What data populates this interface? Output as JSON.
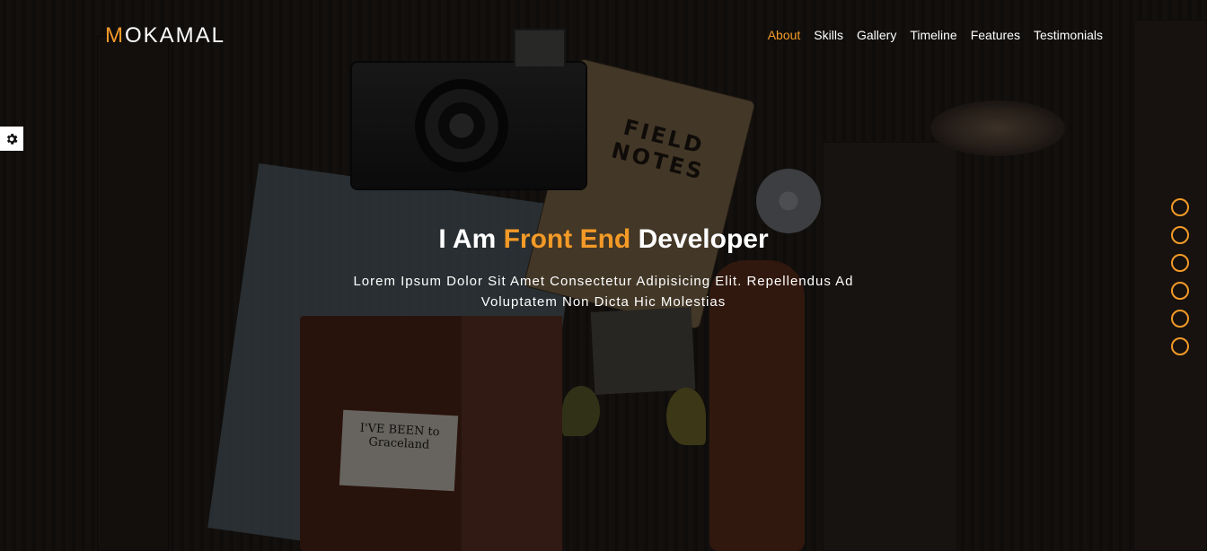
{
  "brand": {
    "logo_first_letter": "M",
    "logo_rest": "OKAMAL"
  },
  "nav": {
    "items": [
      {
        "label": "About",
        "active": true
      },
      {
        "label": "Skills",
        "active": false
      },
      {
        "label": "Gallery",
        "active": false
      },
      {
        "label": "Timeline",
        "active": false
      },
      {
        "label": "Features",
        "active": false
      },
      {
        "label": "Testimonials",
        "active": false
      }
    ]
  },
  "settings": {
    "icon": "gear-icon"
  },
  "hero": {
    "headline_start": "I Am ",
    "headline_highlight": "Front End",
    "headline_end": " Developer",
    "subtitle": "Lorem Ipsum Dolor Sit Amet Consectetur Adipisicing Elit. Repellendus Ad Voluptatem Non Dicta Hic Molestias",
    "photo_texts": {
      "notes": "FIELD NOTES",
      "card": "I'VE BEEN to Graceland"
    }
  },
  "section_dots": {
    "count": 6
  },
  "colors": {
    "accent": "#f39a27",
    "text": "#ffffff",
    "background": "#1f1a17"
  }
}
